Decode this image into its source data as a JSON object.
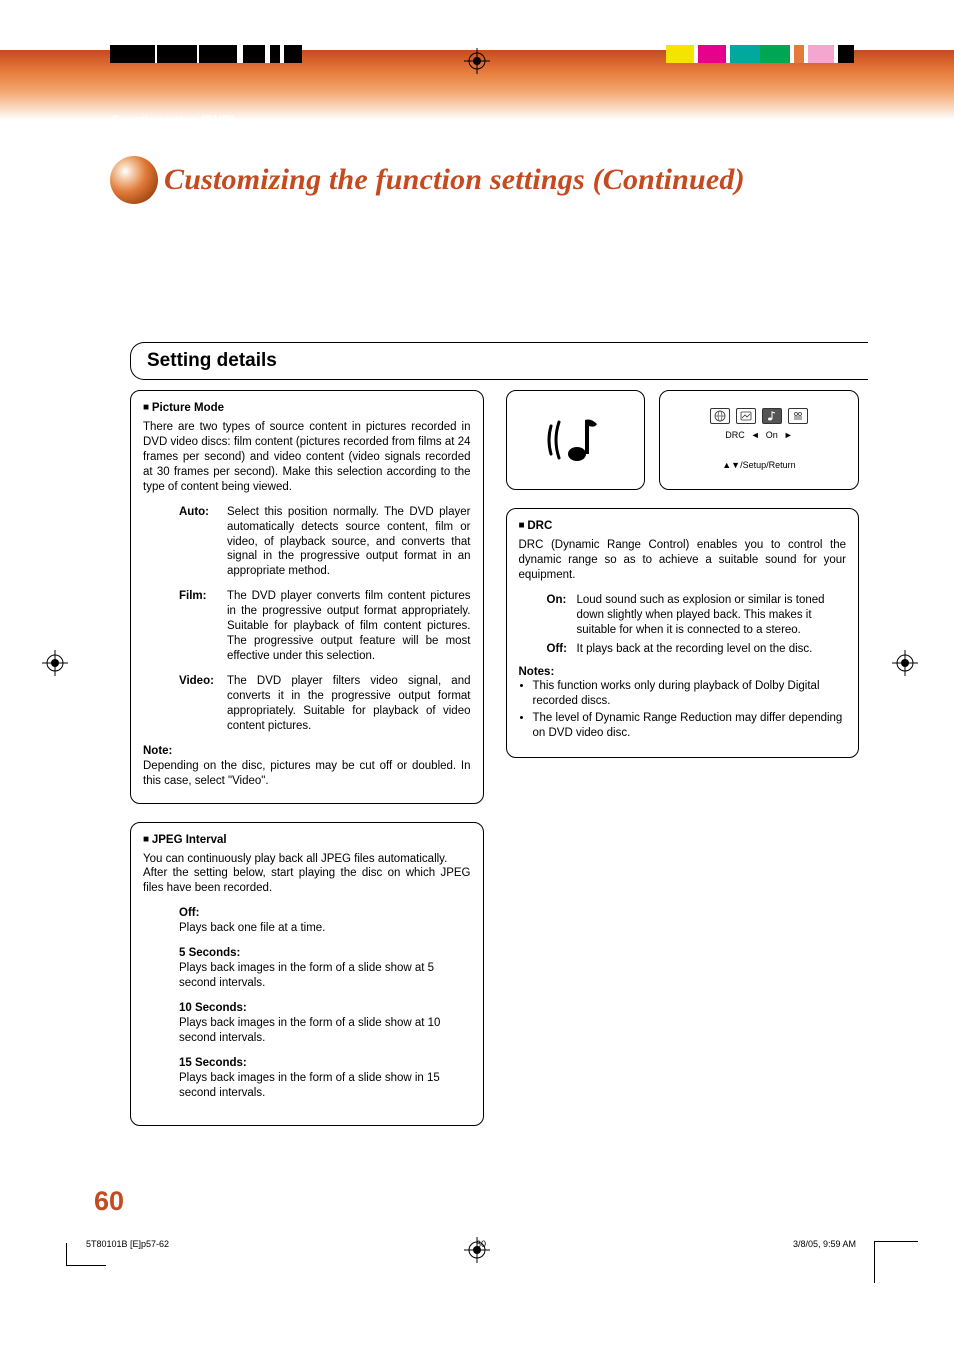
{
  "breadcrumb": "Function setup (DVD)",
  "page_title": "Customizing the function settings (Continued)",
  "section_title": "Setting details",
  "page_number": "60",
  "left": {
    "picture_mode": {
      "heading": "Picture Mode",
      "intro": "There are two types of source content in pictures recorded in DVD video discs: film content (pictures recorded from films at 24 frames per second) and video content (video signals recorded at 30 frames per second). Make this selection according to the type of content being viewed.",
      "items": [
        {
          "label": "Auto:",
          "body": "Select this position normally.\nThe DVD player automatically detects source content, film or video, of playback source, and converts that signal in the progressive output format in an appropriate method."
        },
        {
          "label": "Film:",
          "body": "The DVD player converts film content pictures in the progressive output format appropriately. Suitable for playback of film content pictures. The progressive output feature will be most effective under this selection."
        },
        {
          "label": "Video:",
          "body": "The DVD player filters video signal, and converts it in the progressive output format appropriately.\nSuitable for playback of video content pictures."
        }
      ],
      "note_label": "Note:",
      "note_body": "Depending on the disc, pictures may be cut off or doubled. In this case, select \"Video\"."
    },
    "jpeg": {
      "heading": "JPEG Interval",
      "intro1": "You can continuously play back all JPEG files automatically.",
      "intro2": "After the setting below, start playing the disc on which JPEG files have been recorded.",
      "items": [
        {
          "label": "Off:",
          "body": "Plays back one file at a time."
        },
        {
          "label": "5 Seconds:",
          "body": "Plays back images in the form of a slide show at 5 second intervals."
        },
        {
          "label": "10 Seconds:",
          "body": "Plays back images in the form of a slide show at 10 second intervals."
        },
        {
          "label": "15 Seconds:",
          "body": "Plays back images in the form of a slide show in 15 second intervals."
        }
      ]
    }
  },
  "right": {
    "osd": {
      "label": "DRC",
      "value": "On",
      "return": "▲▼/Setup/Return"
    },
    "drc": {
      "heading": "DRC",
      "intro": "DRC (Dynamic Range Control) enables you to control the dynamic range so as to achieve a suitable sound for your equipment.",
      "items": [
        {
          "label": "On:",
          "body": "Loud sound such as explosion or similar is toned down slightly when played back. This makes it suitable for when it is connected to a stereo."
        },
        {
          "label": "Off:",
          "body": "It plays back at the recording level on the disc."
        }
      ],
      "notes_label": "Notes:",
      "notes": [
        "This function works only during playback of Dolby Digital recorded discs.",
        "The level of Dynamic Range Reduction may differ depending on DVD video disc."
      ]
    }
  },
  "footer": {
    "left": "5T80101B [E]p57-62",
    "center": "60",
    "right": "3/8/05, 9:59 AM"
  }
}
